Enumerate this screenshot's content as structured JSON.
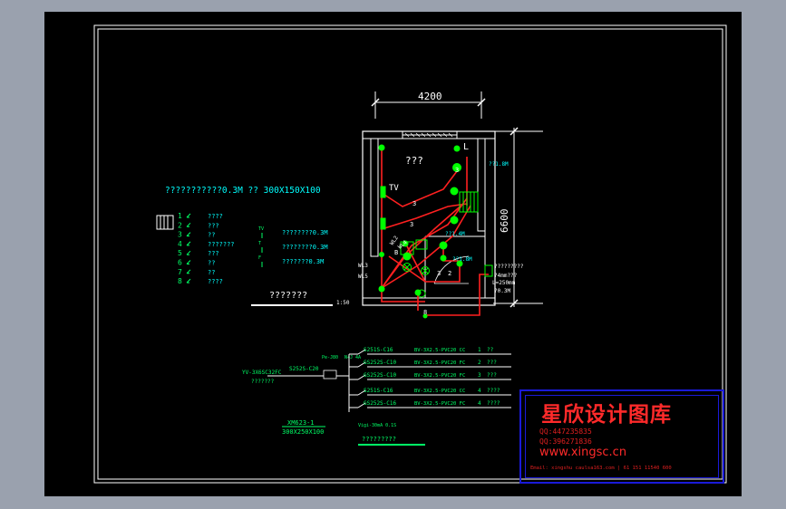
{
  "plan": {
    "dim_width": "4200",
    "dim_height": "6600",
    "room_label": "???",
    "tv_label": "TV",
    "socket_l": "L",
    "note_1_8m_a": "??1.8M",
    "note_1_4m": "??1.4M",
    "note_1_8m_b": "??1.8M",
    "wire_3a": "3",
    "wire_3b": "3",
    "wire_3c": "3",
    "wire_3d": "3",
    "wire_wl2": "WL2",
    "wire_wl4": "WL4",
    "wire_wl5": "WL5",
    "wire_wl3": "WL3",
    "panel_note": "?????????",
    "panel_size": "?4mm???",
    "panel_len": "L=250mm",
    "panel_height": "?0.3M",
    "mark_8": "8",
    "mark_2": "2",
    "mark_b": "B"
  },
  "legend": {
    "title": "???????????0.3M ?? 300X150X100",
    "items": [
      {
        "num": "1",
        "text": "????"
      },
      {
        "num": "2",
        "text": "???"
      },
      {
        "num": "3",
        "text": "??"
      },
      {
        "num": "4",
        "text": "???????"
      },
      {
        "num": "5",
        "text": "???"
      },
      {
        "num": "6",
        "text": "??"
      },
      {
        "num": "7",
        "text": "??"
      },
      {
        "num": "8",
        "text": "????"
      }
    ],
    "sockets": [
      {
        "text": "????????0.3M",
        "sym": "TV"
      },
      {
        "text": "????????0.3M",
        "sym": "T"
      },
      {
        "text": "???????0.3M",
        "sym": "F"
      }
    ],
    "plan_title": "???????",
    "scale": "1:50"
  },
  "system": {
    "incoming_cable": "YV-3X6SC32FC",
    "incoming_note": "???????",
    "main_breaker": "S252S-C20",
    "pe_label": "Pe-J80",
    "n_label": "N+J 4A",
    "circuits": [
      {
        "breaker": "S251S-C16",
        "cable": "BV-3X2.5-PVC20 CC",
        "no": "1",
        "desc": "??"
      },
      {
        "breaker": "GS252S-C10",
        "cable": "BV-3X2.5-PVC20 FC",
        "no": "2",
        "desc": "???"
      },
      {
        "breaker": "GS252S-C10",
        "cable": "BV-3X2.5-PVC20 FC",
        "no": "3",
        "desc": "???"
      },
      {
        "breaker": "S251S-C16",
        "cable": "BV-3X2.5-PVC20 CC",
        "no": "4",
        "desc": "????"
      },
      {
        "breaker": "GS252S-C16",
        "cable": "BV-3X2.5-PVC20 FC",
        "no": "4",
        "desc": "????"
      }
    ],
    "rcd_note": "Vigi-30mA 0.1S",
    "box_name": "XM623-1",
    "box_size": "300X250X100",
    "diagram_title": "?????????"
  },
  "watermark": {
    "title": "星欣设计图库",
    "qq1": "QQ:447235835",
    "qq2": "QQ:396271836",
    "url": "www.xingsc.cn",
    "email": "Email: xingshu caulsa163.com  | 61  151 11540  600"
  },
  "colors": {
    "background": "#000000",
    "wall": "#ffffff",
    "wire": "#ff2020",
    "device": "#00ff00",
    "text_green": "#00ff66",
    "text_cyan": "#00ffff",
    "watermark_red": "#ff2a2a",
    "watermark_border": "#1a1ad8"
  }
}
